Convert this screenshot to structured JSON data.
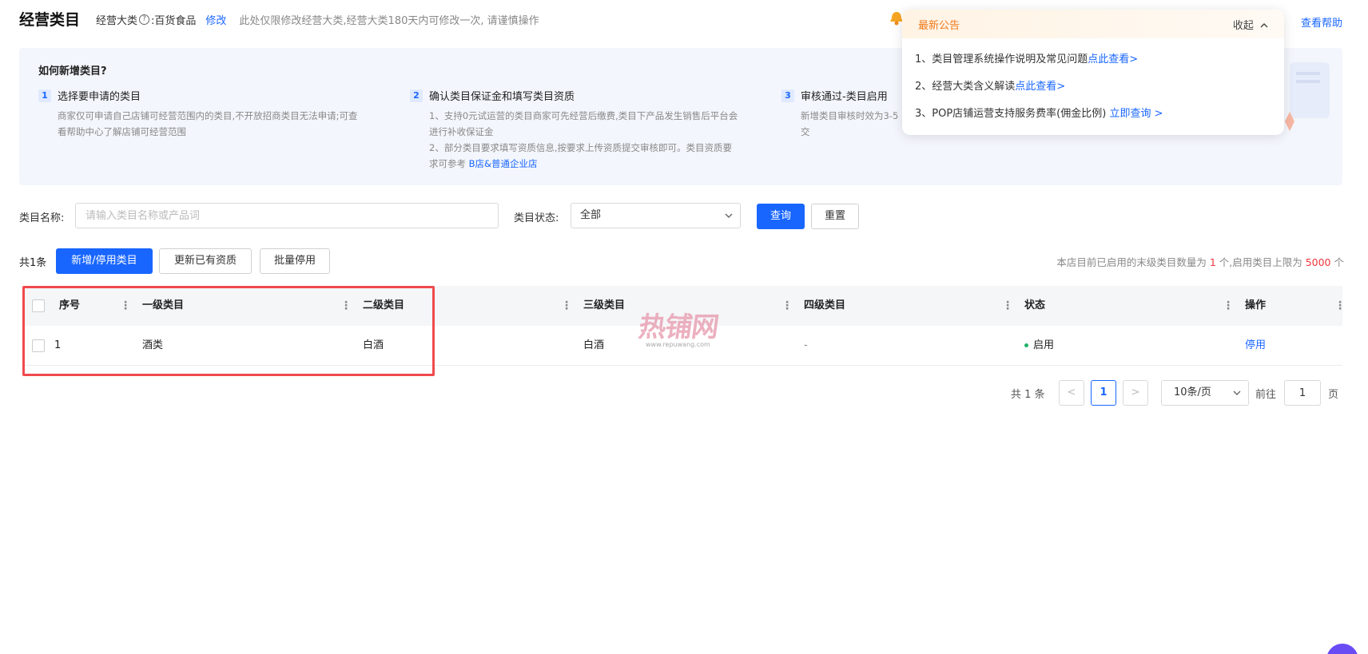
{
  "header": {
    "title": "经营类目",
    "major_label": "经营大类",
    "help_q": "?",
    "major_value": ":百货食品",
    "edit": "修改",
    "note": "此处仅限修改经营大类,经营大类180天内可修改一次, 请谨慎操作",
    "help_link": "查看帮助"
  },
  "guide": {
    "title": "如何新增类目?",
    "steps": [
      {
        "no": "1",
        "title": "选择要申请的类目",
        "lines": [
          "商家仅可申请自己店铺可经营范围内的类目,不开放招商类目无法申请;可查",
          "看帮助中心了解店铺可经营范围"
        ]
      },
      {
        "no": "2",
        "title": "确认类目保证金和填写类目资质",
        "lines": [
          "1、支持0元试运营的类目商家可先经营后缴费,类目下产品发生销售后平台会",
          "进行补收保证金",
          "2、部分类目要求填写资质信息,按要求上传资质提交审核即可。类目资质要",
          "求可参考 "
        ],
        "link": "B店&普通企业店"
      },
      {
        "no": "3",
        "title": "审核通过-类目启用",
        "lines": [
          "新增类目审核时效为3-5",
          "交"
        ]
      }
    ]
  },
  "notice": {
    "title": "最新公告",
    "collapse": "收起",
    "items": [
      {
        "text": "1、类目管理系统操作说明及常见问题",
        "link": "点此查看>"
      },
      {
        "text": "2、经营大类含义解读",
        "link": "点此查看>"
      },
      {
        "text": "3、POP店铺运营支持服务费率(佣金比例)",
        "link": "立即查询 >"
      }
    ]
  },
  "filters": {
    "name_label": "类目名称:",
    "name_placeholder": "请输入类目名称或产品词",
    "status_label": "类目状态:",
    "status_value": "全部",
    "query": "查询",
    "reset": "重置"
  },
  "toolbar": {
    "total": "共1条",
    "add_btn": "新增/停用类目",
    "update_btn": "更新已有资质",
    "batch_btn": "批量停用",
    "count_note_a": "本店目前已启用的末级类目数量为 ",
    "count_enabled": "1",
    "count_note_b": " 个,启用类目上限为 ",
    "count_limit": "5000",
    "count_note_c": " 个"
  },
  "table": {
    "headers": [
      "序号",
      "一级类目",
      "二级类目",
      "三级类目",
      "四级类目",
      "状态",
      "操作"
    ],
    "rows": [
      {
        "index": "1",
        "level1": "酒类",
        "level2": "白酒",
        "level3": "白酒",
        "level4": "-",
        "status": "启用",
        "action": "停用"
      }
    ]
  },
  "pagination": {
    "total": "共 1 条",
    "prev": "<",
    "current": "1",
    "next": ">",
    "size": "10条/页",
    "goto": "前往",
    "page_value": "1",
    "page_unit": "页"
  },
  "watermark": {
    "text": "热铺网",
    "sub": "www.repuwang.com"
  },
  "colors": {
    "primary": "#1966ff",
    "highlight": "#f04a4d",
    "notice": "#f07a1c",
    "enabled": "#21b36a"
  }
}
